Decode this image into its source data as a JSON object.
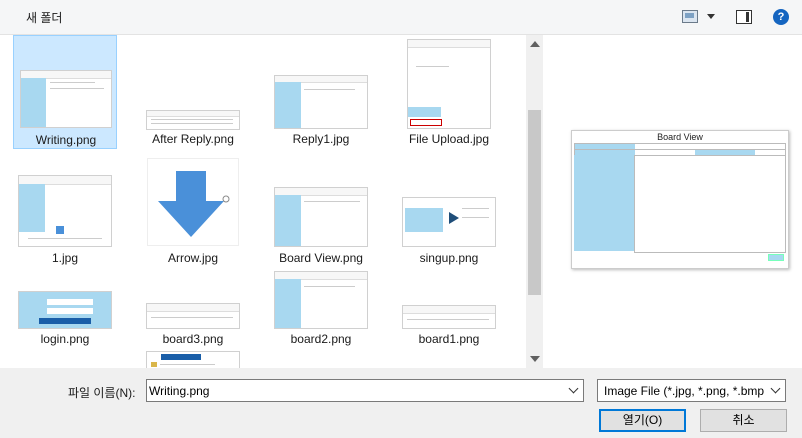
{
  "toolbar": {
    "new_folder": "새 폴더",
    "help": "?"
  },
  "files": [
    {
      "name": "Writing.png",
      "selected": true
    },
    {
      "name": "After Reply.png"
    },
    {
      "name": "Reply1.jpg"
    },
    {
      "name": "File Upload.jpg"
    },
    {
      "name": "1.jpg"
    },
    {
      "name": "Arrow.jpg"
    },
    {
      "name": "Board View.png"
    },
    {
      "name": "singup.png"
    },
    {
      "name": "login.png"
    },
    {
      "name": "board3.png"
    },
    {
      "name": "board2.png"
    },
    {
      "name": "board1.png"
    }
  ],
  "preview": {
    "title": "Board View"
  },
  "filename": {
    "label": "파일 이름(N):",
    "value": "Writing.png"
  },
  "filetype": {
    "value": "Image File (*.jpg, *.png, *.bmp"
  },
  "buttons": {
    "open": "열기(O)",
    "cancel": "취소"
  },
  "colors": {
    "selection": "#cce8ff",
    "accent": "#0078d7",
    "thumb_side": "#a8d8f0",
    "arrow": "#4a90d9"
  }
}
